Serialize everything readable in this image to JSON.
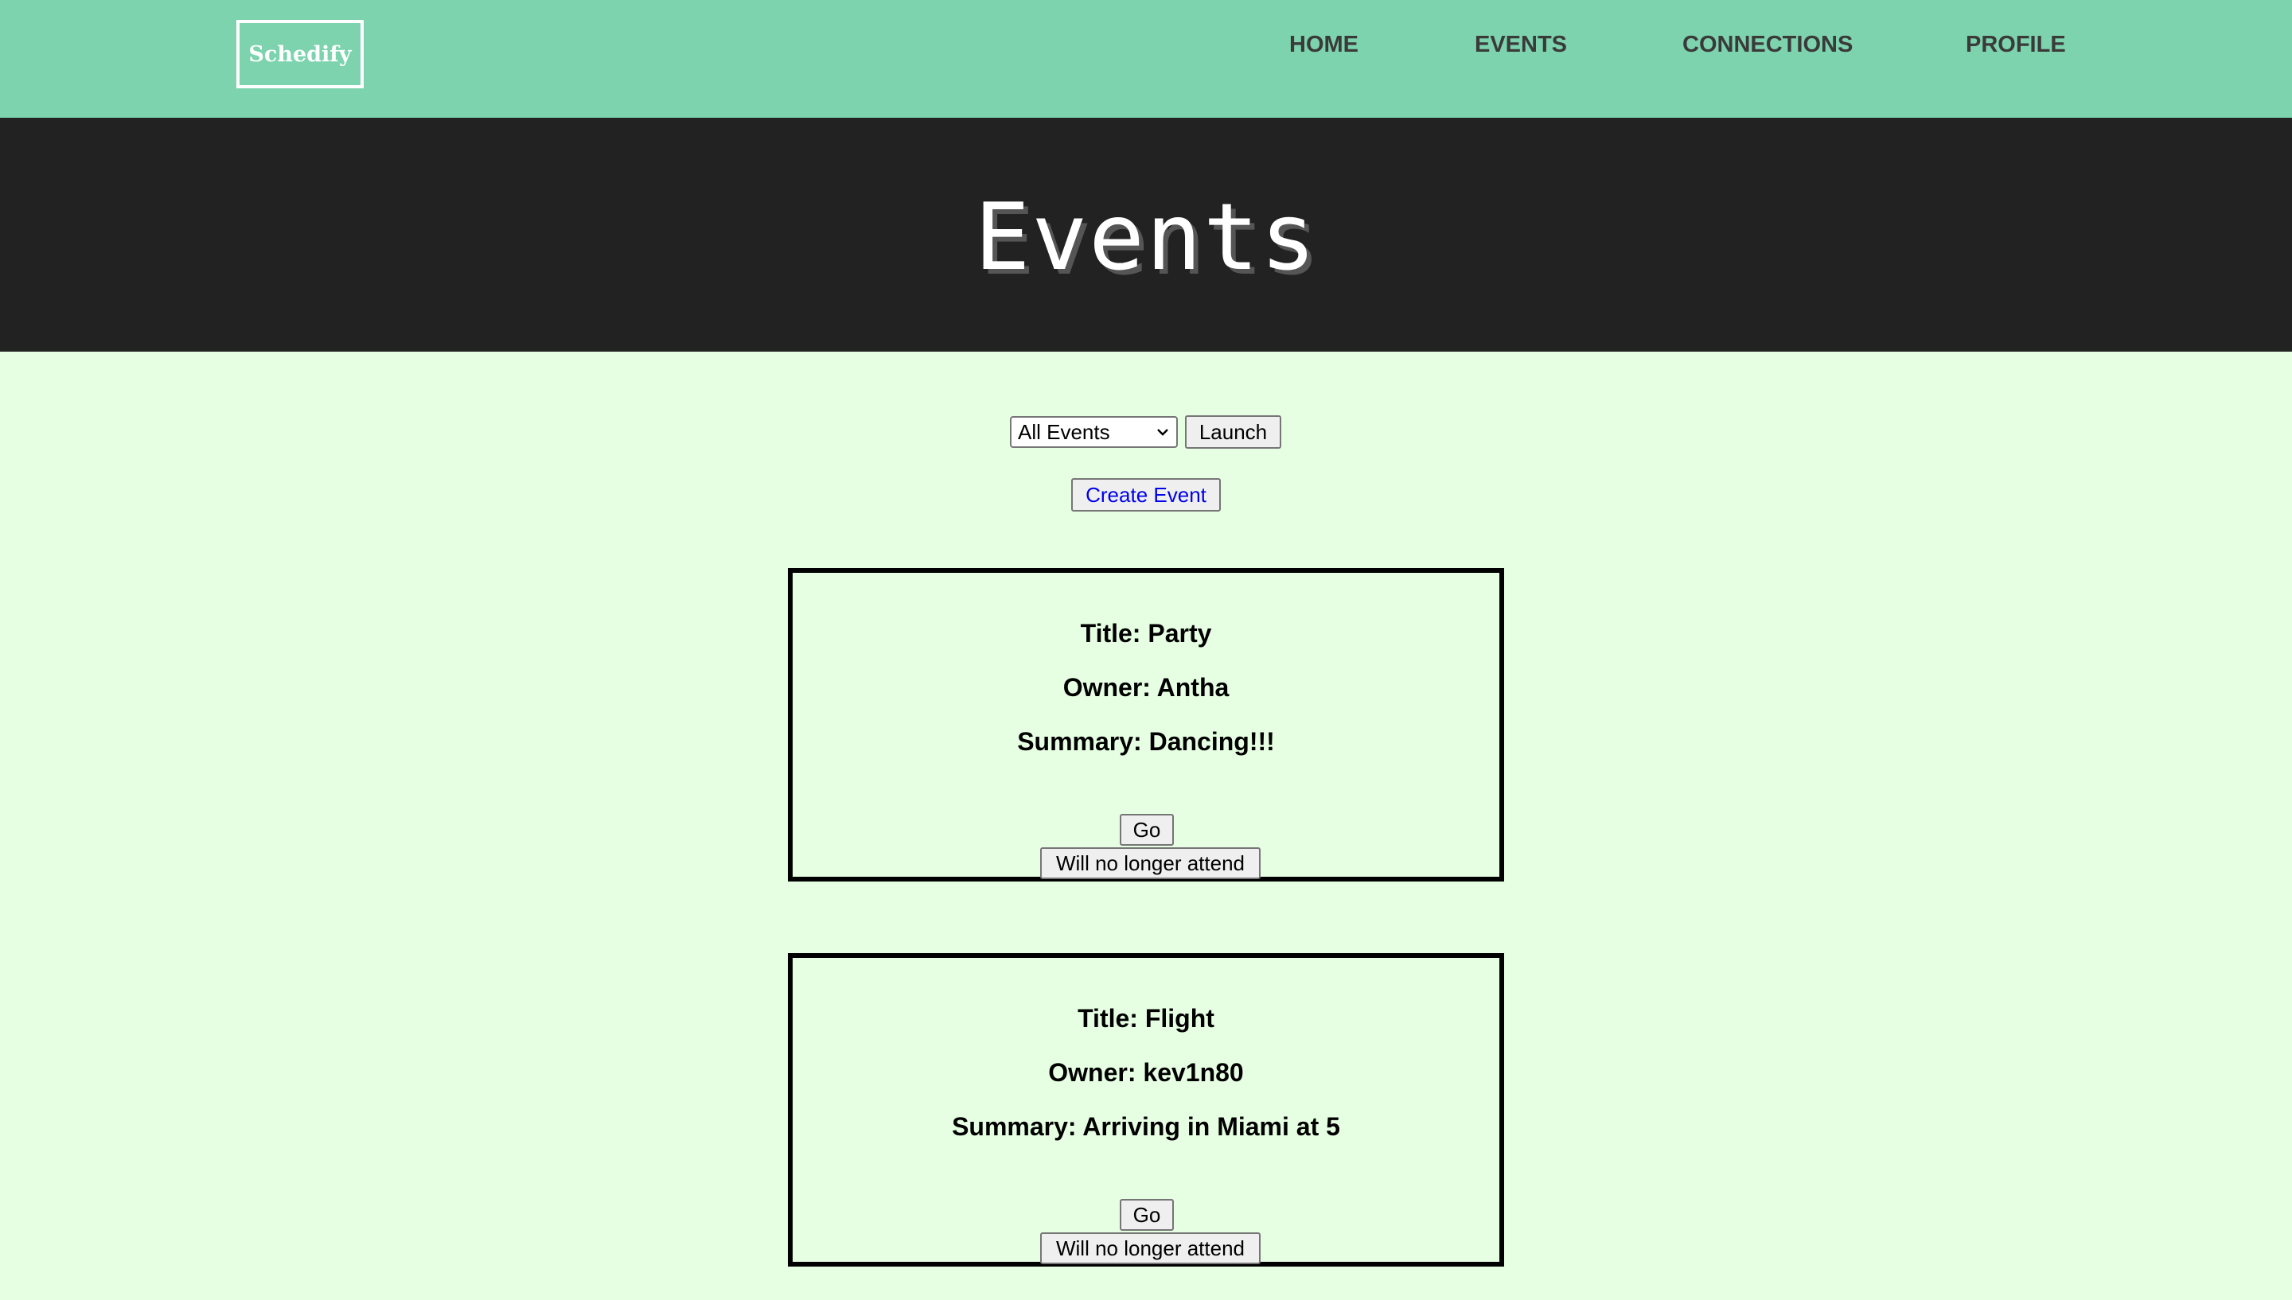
{
  "navbar": {
    "logo": "Schedify",
    "links": [
      "HOME",
      "EVENTS",
      "CONNECTIONS",
      "PROFILE"
    ]
  },
  "hero": {
    "title": "Events"
  },
  "controls": {
    "filter_selected": "All Events",
    "launch_label": "Launch",
    "create_label": "Create Event"
  },
  "events": [
    {
      "title": "Title: Party",
      "owner": "Owner: Antha",
      "summary": "Summary: Dancing!!!",
      "go_label": "Go",
      "leave_label": "Will no longer attend"
    },
    {
      "title": "Title: Flight",
      "owner": "Owner: kev1n80",
      "summary": "Summary: Arriving in Miami at 5",
      "go_label": "Go",
      "leave_label": "Will no longer attend"
    }
  ],
  "colors": {
    "navbar_bg": "#7dd3ae",
    "hero_bg": "#222222",
    "page_bg": "#e6ffe2",
    "link_accent": "#0000ee"
  },
  "icons": {
    "select_arrow": "chevron-down-icon"
  }
}
